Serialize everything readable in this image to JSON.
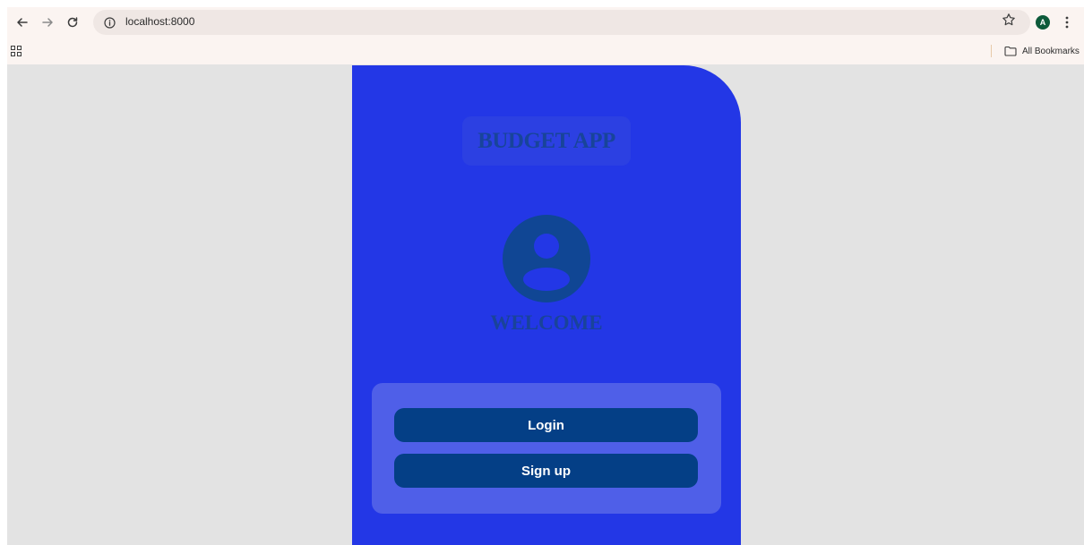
{
  "browser": {
    "url": "localhost:8000",
    "profile_initial": "A",
    "bookmarks_label": "All Bookmarks"
  },
  "icons": {
    "back": "arrow-left",
    "forward": "arrow-right",
    "reload": "reload",
    "site_info": "info-circle",
    "bookmark_star": "star-outline",
    "menu": "kebab-menu",
    "apps": "apps-grid",
    "folder": "folder-outline",
    "user": "account-circle"
  },
  "app": {
    "title": "BUDGET APP",
    "welcome": "WELCOME",
    "login_label": "Login",
    "signup_label": "Sign up"
  },
  "colors": {
    "panel": "#2337e6",
    "card": "#4f5fe8",
    "button": "#043f86",
    "title_text": "#18449a",
    "page_background": "#e3e3e3"
  }
}
